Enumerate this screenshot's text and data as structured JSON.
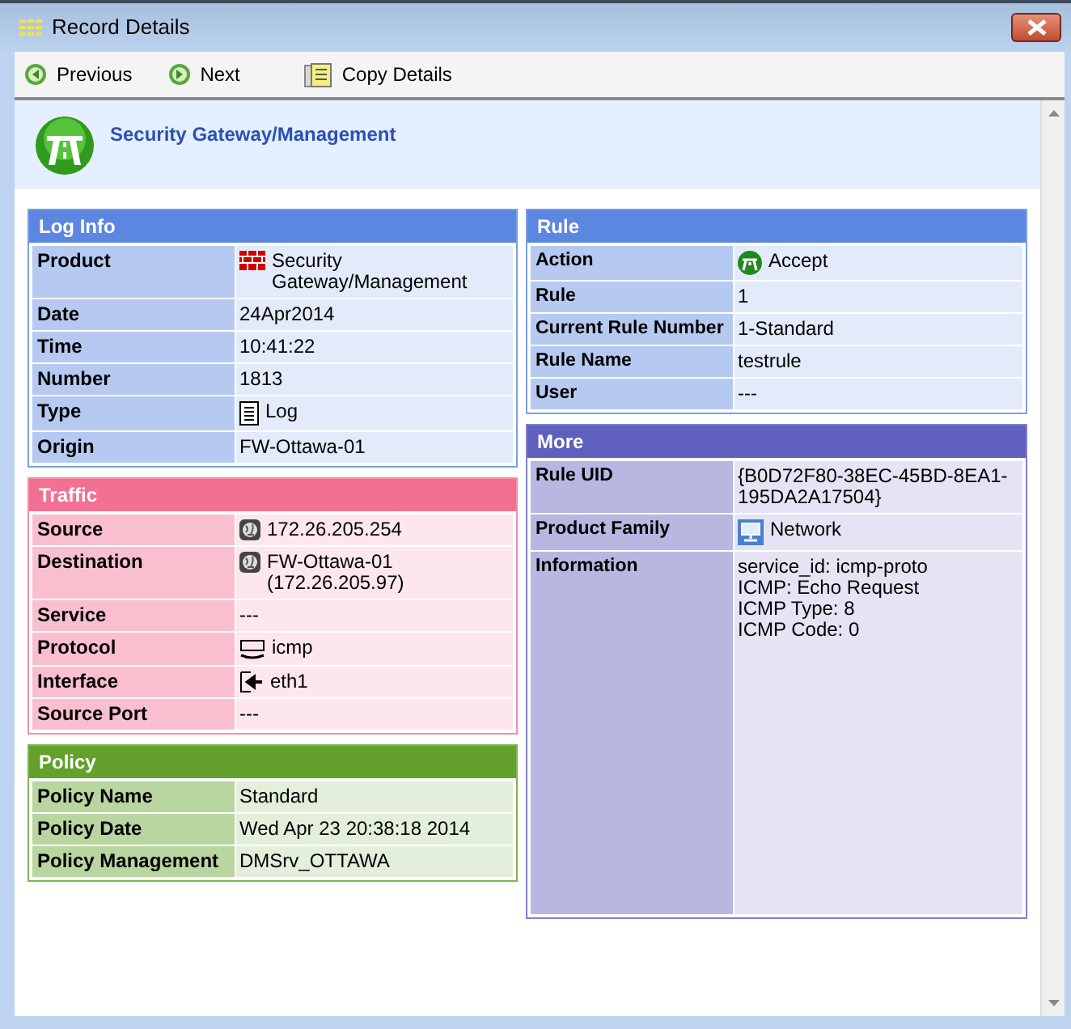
{
  "window": {
    "title": "Record Details"
  },
  "toolbar": [
    {
      "label": "Previous",
      "kind": "back"
    },
    {
      "label": "Next",
      "kind": "forward"
    },
    {
      "label": "Copy Details",
      "kind": "copy"
    }
  ],
  "header": {
    "title": "Security Gateway/Management"
  },
  "columns": [
    [
      {
        "title": "Log Info",
        "color": "#5b87e0",
        "rows": [
          {
            "label": "Product",
            "value": "Security\nGateway/Management",
            "kind": "firewall"
          },
          {
            "label": "Date",
            "value": "24Apr2014"
          },
          {
            "label": "Time",
            "value": "10:41:22"
          },
          {
            "label": "Number",
            "value": "1813"
          },
          {
            "label": "Type",
            "value": "Log",
            "kind": "log"
          },
          {
            "label": "Origin",
            "value": "FW-Ottawa-01"
          }
        ]
      },
      {
        "title": "Traffic",
        "color": "#f27193",
        "rows": [
          {
            "label": "Source",
            "value": "172.26.205.254",
            "kind": "globe"
          },
          {
            "label": "Destination",
            "value": "FW-Ottawa-01\n(172.26.205.97)",
            "kind": "globe"
          },
          {
            "label": "Service",
            "value": "---"
          },
          {
            "label": "Protocol",
            "value": "icmp",
            "kind": "icmp"
          },
          {
            "label": "Interface",
            "value": "eth1",
            "kind": "interface"
          },
          {
            "label": "Source Port",
            "value": "---"
          }
        ]
      },
      {
        "title": "Policy",
        "color": "#63a12c",
        "rows": [
          {
            "label": "Policy Name",
            "value": "Standard"
          },
          {
            "label": "Policy Date",
            "value": "Wed Apr 23 20:38:18 2014"
          },
          {
            "label": "Policy Management",
            "value": "DMSrv_OTTAWA"
          }
        ]
      }
    ],
    [
      {
        "title": "Rule",
        "color": "#5b87e0",
        "rows": [
          {
            "label": "Action",
            "value": "Accept",
            "kind": "accept"
          },
          {
            "label": "Rule",
            "value": "1"
          },
          {
            "label": "Current Rule Number",
            "value": "1-Standard"
          },
          {
            "label": "Rule Name",
            "value": "testrule"
          },
          {
            "label": "User",
            "value": "---"
          }
        ]
      },
      {
        "title": "More",
        "color": "#5f5fbd",
        "rows": [
          {
            "label": "Rule UID",
            "value": "{B0D72F80-38EC-45BD-8EA1-\n195DA2A17504}"
          },
          {
            "label": "Product Family",
            "value": "Network",
            "kind": "network"
          },
          {
            "label": "Information",
            "value": "service_id: icmp-proto\nICMP: Echo Request\nICMP Type: 8\nICMP Code: 0"
          }
        ]
      }
    ]
  ]
}
